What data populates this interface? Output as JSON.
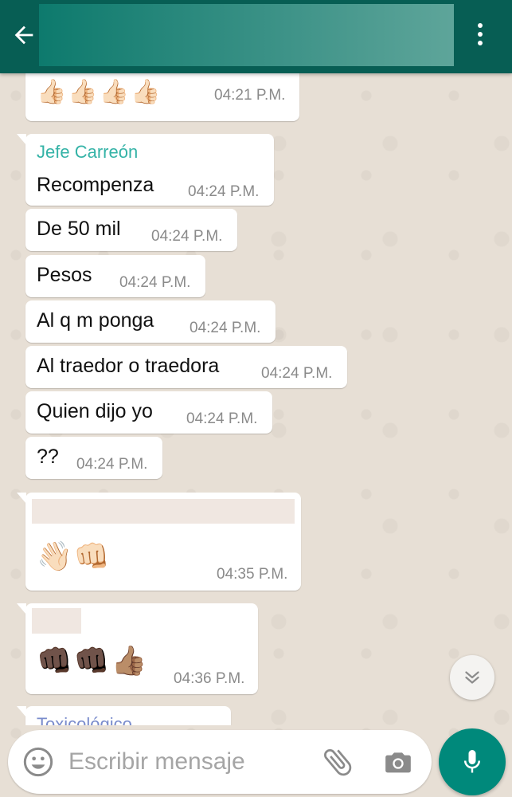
{
  "icons": {
    "back": "arrow-left-icon",
    "menu": "more-vertical-icon",
    "scroll": "double-chevron-down-icon",
    "emoji": "smiley-icon",
    "attach": "paperclip-icon",
    "camera": "camera-icon",
    "mic": "microphone-icon"
  },
  "colors": {
    "appbar": "#075e54",
    "sender": "#35b3a7",
    "mic_button": "#00897b",
    "bubble": "#ffffff"
  },
  "messages": [
    {
      "emoji": "👍🏻👍🏻👍🏻👍🏻",
      "time": "04:21 P.M."
    },
    {
      "sender": "Jefe Carreón",
      "text": "Recompenza",
      "time": "04:24 P.M."
    },
    {
      "text": "De 50 mil",
      "time": "04:24 P.M."
    },
    {
      "text": "Pesos",
      "time": "04:24 P.M."
    },
    {
      "text": "Al q m ponga",
      "time": "04:24 P.M."
    },
    {
      "text": "Al traedor o traedora",
      "time": "04:24 P.M."
    },
    {
      "text": "Quien dijo yo",
      "time": "04:24 P.M."
    },
    {
      "text": "??",
      "time": "04:24 P.M."
    },
    {
      "emoji": "👋🏻👊🏻",
      "time": "04:35 P.M."
    },
    {
      "emoji": "👊🏿👊🏿👍🏽",
      "time": "04:36 P.M."
    },
    {
      "sender": "Toxicológico"
    }
  ],
  "composer": {
    "placeholder": "Escribir mensaje"
  }
}
